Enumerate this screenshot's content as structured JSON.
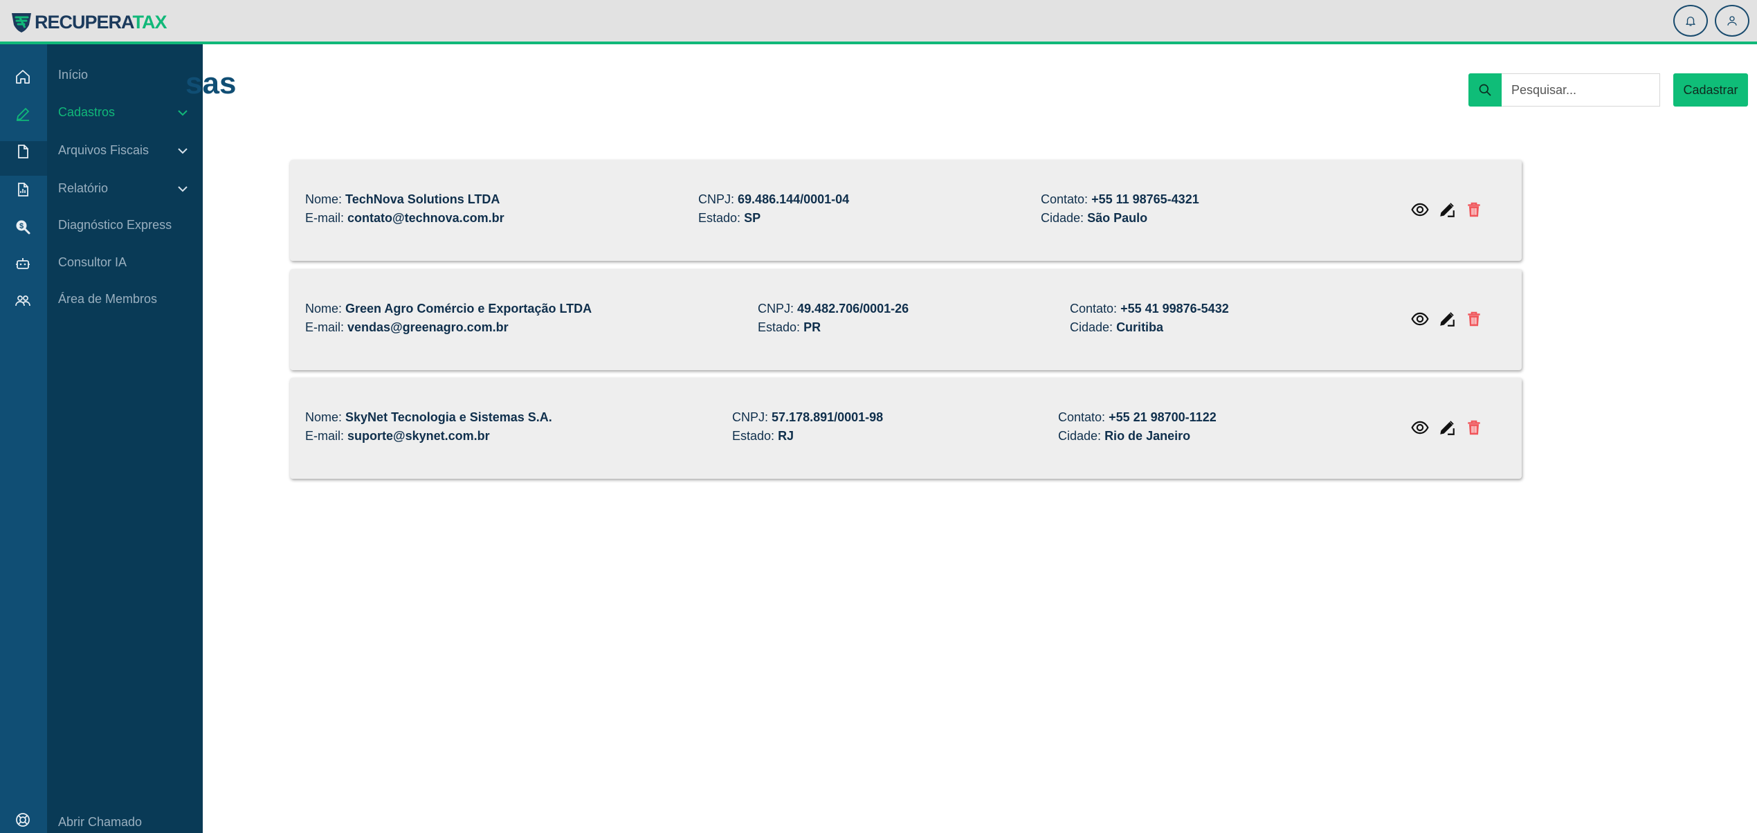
{
  "app": {
    "logo_part1": "RECUPERA",
    "logo_part2": "TAX",
    "brand_color": "#11b879",
    "navy_color": "#104e74"
  },
  "header": {
    "bell_icon": "bell-icon",
    "user_icon": "user-icon"
  },
  "sidebar": {
    "items": [
      {
        "label": "Início",
        "icon": "home-icon"
      },
      {
        "label": "Cadastros",
        "icon": "edit-icon",
        "active": true,
        "has_submenu": true
      },
      {
        "label": "Arquivos Fiscais",
        "icon": "file-icon",
        "has_submenu": true
      },
      {
        "label": "Relatório",
        "icon": "file-chart-icon",
        "has_submenu": true
      },
      {
        "label": "Diagnóstico Express",
        "icon": "search-dollar-icon"
      },
      {
        "label": "Consultor IA",
        "icon": "robot-icon"
      },
      {
        "label": "Área de Membros",
        "icon": "members-icon"
      }
    ],
    "footer": {
      "label": "Abrir Chamado",
      "icon": "support-icon"
    }
  },
  "main": {
    "title_visible": "sas",
    "search": {
      "placeholder": "Pesquisar...",
      "value": ""
    },
    "register_label": "Cadastrar",
    "labels": {
      "name": "Nome:",
      "email": "E-mail:",
      "cnpj": "CNPJ:",
      "state": "Estado:",
      "contact": "Contato:",
      "city": "Cidade:"
    },
    "companies": [
      {
        "name": "TechNova Solutions LTDA",
        "email": "contato@technova.com.br",
        "cnpj": "69.486.144/0001-04",
        "state": "SP",
        "contact": "+55 11 98765-4321",
        "city": "São Paulo"
      },
      {
        "name": "Green Agro Comércio e Exportação LTDA",
        "email": "vendas@greenagro.com.br",
        "cnpj": "49.482.706/0001-26",
        "state": "PR",
        "contact": "+55 41 99876-5432",
        "city": "Curitiba"
      },
      {
        "name": "SkyNet Tecnologia e Sistemas S.A.",
        "email": "suporte@skynet.com.br",
        "cnpj": "57.178.891/0001-98",
        "state": "RJ",
        "contact": "+55 21 98700-1122",
        "city": "Rio de Janeiro"
      }
    ],
    "action_icons": [
      "eye-icon",
      "edit-icon",
      "trash-icon"
    ],
    "delete_color": "#f0565b"
  }
}
